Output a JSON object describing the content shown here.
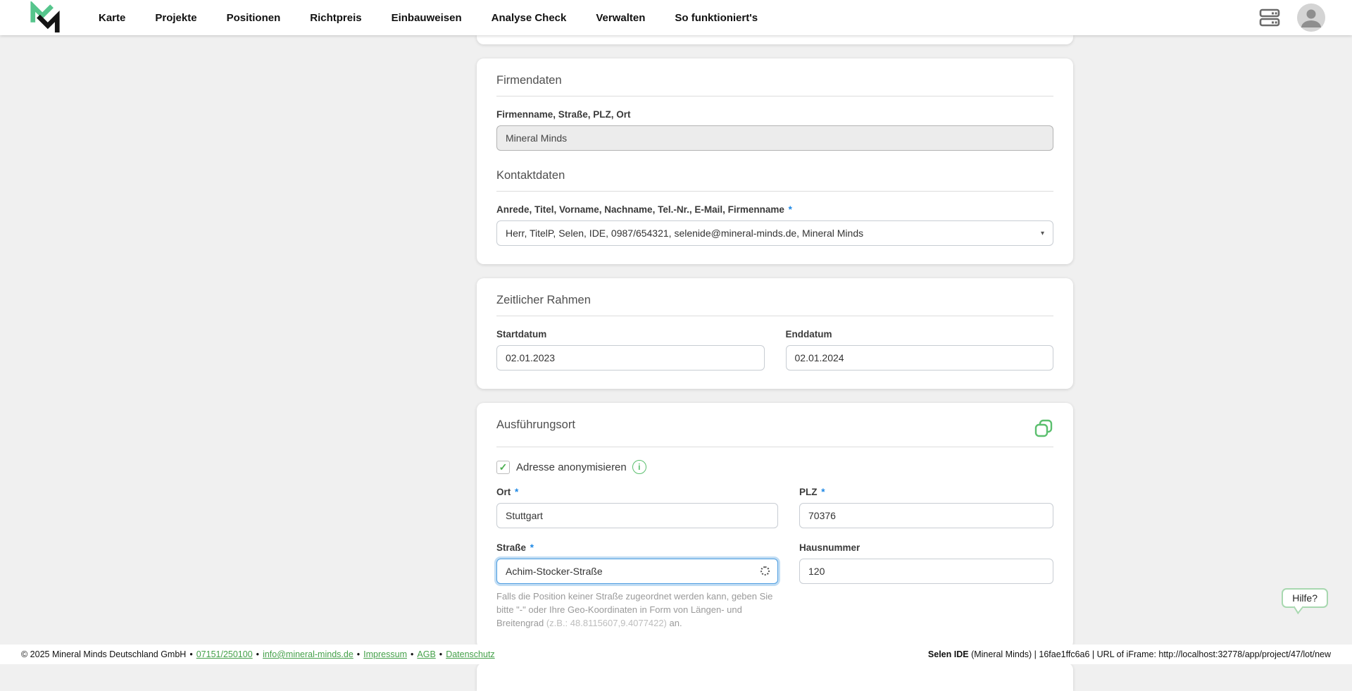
{
  "nav": {
    "items": [
      {
        "label": "Karte"
      },
      {
        "label": "Projekte"
      },
      {
        "label": "Positionen"
      },
      {
        "label": "Richtpreis"
      },
      {
        "label": "Einbauweisen"
      },
      {
        "label": "Analyse Check"
      },
      {
        "label": "Verwalten"
      },
      {
        "label": "So funktioniert's"
      }
    ]
  },
  "ui": {
    "required_mark": "*",
    "select_caret": "▾",
    "checkmark": "✓",
    "info_glyph": "i"
  },
  "cards": {
    "firmendaten": {
      "title": "Firmendaten",
      "field_label": "Firmenname, Straße, PLZ, Ort",
      "field_value": "Mineral Minds"
    },
    "kontaktdaten": {
      "title": "Kontaktdaten",
      "field_label": "Anrede, Titel, Vorname, Nachname, Tel.-Nr., E-Mail, Firmenname",
      "select_value": "Herr, TitelP, Selen, IDE, 0987/654321, selenide@mineral-minds.de, Mineral Minds"
    },
    "zeitlicher_rahmen": {
      "title": "Zeitlicher Rahmen",
      "startdatum_label": "Startdatum",
      "startdatum_value": "02.01.2023",
      "enddatum_label": "Enddatum",
      "enddatum_value": "02.01.2024"
    },
    "ausfuehrungsort": {
      "title": "Ausführungsort",
      "anonymize_label": "Adresse anonymisieren",
      "ort_label": "Ort",
      "ort_value": "Stuttgart",
      "plz_label": "PLZ",
      "plz_value": "70376",
      "strasse_label": "Straße",
      "strasse_value": "Achim-Stocker-Straße",
      "hausnummer_label": "Hausnummer",
      "hausnummer_value": "120",
      "help_text_main": "Falls die Position keiner Straße zugeordnet werden kann, geben Sie bitte \"-\" oder Ihre Geo-Koordinaten in Form von Längen- und Breitengrad ",
      "help_text_coords": "(z.B.: 48.8115607,9.4077422)",
      "help_text_suffix": " an."
    }
  },
  "help_button": {
    "label": "Hilfe?"
  },
  "footer": {
    "copyright": "© 2025 Mineral Minds Deutschland GmbH",
    "separator": "•",
    "links": [
      "07151/250100",
      "info@mineral-minds.de",
      "Impressum",
      "AGB",
      "Datenschutz"
    ],
    "right_bold": "Selen IDE",
    "right_rest": " (Mineral Minds) | 16fae1ffc6a6 | URL of iFrame: http://localhost:32778/app/project/47/lot/new"
  },
  "colors": {
    "accent_green": "#56c58c",
    "icon_green": "#5bbf6e",
    "link_green": "#44a049",
    "required_blue": "#1e88e5",
    "focus_blue": "#4d9de0",
    "page_background": "#f0f0f0"
  }
}
